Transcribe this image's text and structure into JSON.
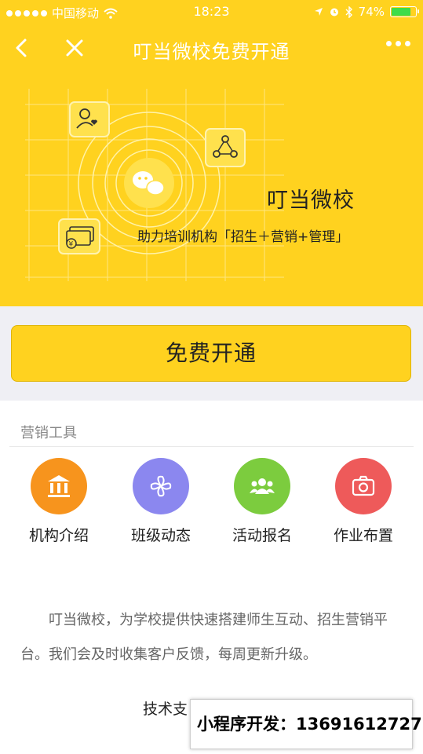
{
  "status_bar": {
    "carrier": "中国移动",
    "time": "18:23",
    "battery": "74%"
  },
  "navbar": {
    "title": "叮当微校免费开通"
  },
  "hero": {
    "title": "叮当微校",
    "subtitle": "助力培训机构「招生＋营销+管理」"
  },
  "cta": {
    "label": "免费开通"
  },
  "marketing": {
    "section_label": "营销工具",
    "tools": [
      {
        "label": "机构介绍",
        "icon": "institution-icon",
        "color": "#f7941d"
      },
      {
        "label": "班级动态",
        "icon": "pinwheel-icon",
        "color": "#8b87ef"
      },
      {
        "label": "活动报名",
        "icon": "group-icon",
        "color": "#7ccc3e"
      },
      {
        "label": "作业布置",
        "icon": "camera-icon",
        "color": "#ee5a5a"
      }
    ]
  },
  "description": "叮当微校，为学校提供快速搭建师生互动、招生营销平台。我们会及时收集客户反馈，每周更新升级。",
  "support_text": "技术支",
  "overlay": {
    "text": "小程序开发：13691612727"
  },
  "colors": {
    "brand_yellow": "#ffd21f",
    "band_gray": "#efeff4"
  }
}
